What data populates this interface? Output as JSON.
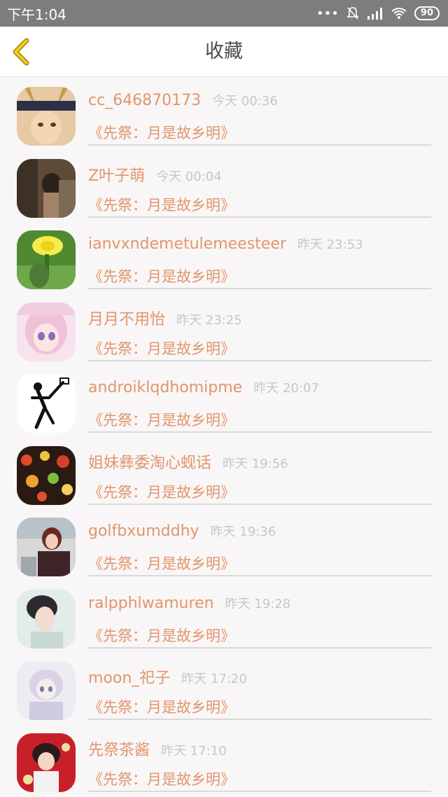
{
  "status_bar": {
    "time": "下午1:04",
    "battery": "90"
  },
  "header": {
    "title": "收藏"
  },
  "favorites": [
    {
      "name": "cc_646870173",
      "time": "今天 00:36",
      "collection": "《先祭：月是故乡明》"
    },
    {
      "name": "Z叶子萌",
      "time": "今天 00:04",
      "collection": "《先祭：月是故乡明》"
    },
    {
      "name": "ianvxndemetulemeesteer",
      "time": "昨天 23:53",
      "collection": "《先祭：月是故乡明》"
    },
    {
      "name": "月月不用怡",
      "time": "昨天 23:25",
      "collection": "《先祭：月是故乡明》"
    },
    {
      "name": "androiklqdhomipme",
      "time": "昨天 20:07",
      "collection": "《先祭：月是故乡明》"
    },
    {
      "name": "姐妹彝委淘心蚬话",
      "time": "昨天 19:56",
      "collection": "《先祭：月是故乡明》"
    },
    {
      "name": "golfbxumddhy",
      "time": "昨天 19:36",
      "collection": "《先祭：月是故乡明》"
    },
    {
      "name": "ralpphlwamuren",
      "time": "昨天 19:28",
      "collection": "《先祭：月是故乡明》"
    },
    {
      "name": "moon_祀子",
      "time": "昨天 17:20",
      "collection": "《先祭：月是故乡明》"
    },
    {
      "name": "先祭茶酱",
      "time": "昨天 17:10",
      "collection": "《先祭：月是故乡明》"
    }
  ]
}
